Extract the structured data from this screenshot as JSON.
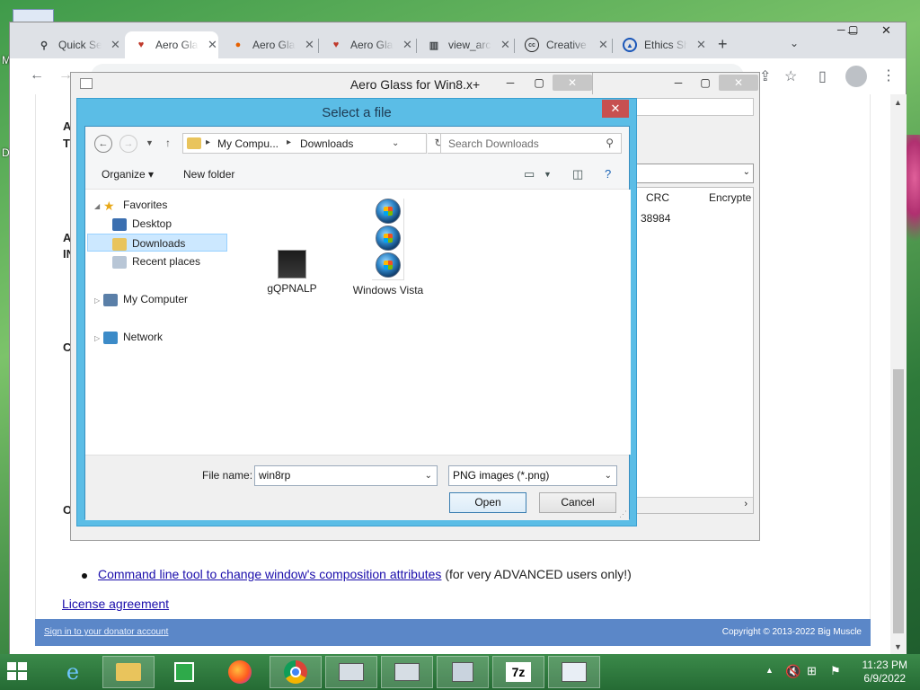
{
  "colors": {
    "accent": "#5bbde6",
    "footer": "#5b87c8",
    "link": "#1a0dab",
    "close_red": "#c75050"
  },
  "browser": {
    "tabs": [
      {
        "title": "Quick Se",
        "icon": "search-icon"
      },
      {
        "title": "Aero Gla",
        "icon": "bigmuscle-icon"
      },
      {
        "title": "Aero Gla",
        "icon": "firefox-icon"
      },
      {
        "title": "Aero Gla",
        "icon": "bigmuscle-icon"
      },
      {
        "title": "view_arc",
        "icon": "archive-icon"
      },
      {
        "title": "Creative",
        "icon": "cc-icon"
      },
      {
        "title": "Ethics Sh",
        "icon": "ethics-icon"
      }
    ],
    "new_tab": "+",
    "page": {
      "cut_letters": [
        "A",
        "T",
        "A",
        "IN",
        "C",
        "O"
      ],
      "bullet_link": "Command line tool to change window's composition attributes",
      "bullet_suffix": " (for very ADVANCED users only!)",
      "license_link": "License agreement",
      "footer_left": "Sign in to your donator account",
      "footer_right": "Copyright © 2013-2022 Big Muscle"
    }
  },
  "app_window": {
    "title": "Aero Glass for Win8.x+",
    "table_headers": [
      "CRC",
      "Encrypte"
    ],
    "table_cell": "38984"
  },
  "dialog": {
    "title": "Select a file",
    "breadcrumb": [
      "My Compu...",
      "Downloads"
    ],
    "search_placeholder": "Search Downloads",
    "organize": "Organize",
    "new_folder": "New folder",
    "nav": {
      "favorites": "Favorites",
      "desktop": "Desktop",
      "downloads": "Downloads",
      "recent": "Recent places",
      "computer": "My Computer",
      "network": "Network"
    },
    "files": [
      {
        "name": "gQPNALP",
        "icon": "black-image-icon"
      },
      {
        "name": "Windows Vista",
        "icon": "windows-orb-icon"
      }
    ],
    "file_name_label": "File name:",
    "file_name_value": "win8rp",
    "file_type": "PNG images (*.png)",
    "open": "Open",
    "cancel": "Cancel"
  },
  "taskbar": {
    "time": "11:23 PM",
    "date": "6/9/2022",
    "buttons": [
      "internet-explorer-icon",
      "file-explorer-icon",
      "store-icon",
      "firefox-icon",
      "chrome-icon",
      "performance-monitor-icon",
      "performance-monitor-icon",
      "network-tool-icon",
      "7zip-icon",
      "app-window-icon"
    ],
    "sevenzip_label": "7z"
  }
}
